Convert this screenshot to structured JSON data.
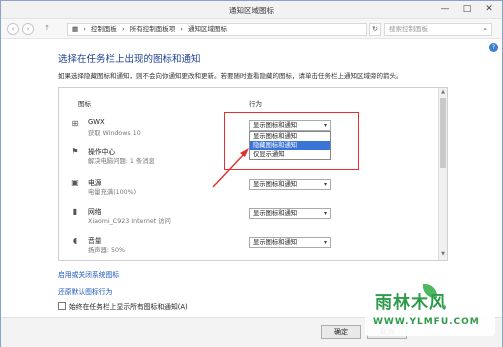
{
  "window": {
    "title": "通知区域图标",
    "min": "—",
    "max": "□",
    "close": "✕"
  },
  "address": {
    "back": "‹",
    "forward": "›",
    "up": "↑",
    "crumbs": [
      "▦",
      "›",
      "控制面板",
      "›",
      "所有控制面板项",
      "›",
      "通知区域图标"
    ],
    "refresh": "↻",
    "search_placeholder": "搜索控制面板",
    "search_icon": "search-icon"
  },
  "help": "?",
  "heading": "选择在任务栏上出现的图标和通知",
  "description": "如果选择隐藏图标和通知，则不会向你通知更改和更新。若要随时查看隐藏的图标，请单击任务栏上通知区域旁的箭头。",
  "table": {
    "col_icon": "图标",
    "col_behavior": "行为",
    "rows": [
      {
        "icon": "windows-icon",
        "glyph": "⊞",
        "name": "GWX",
        "sub": "获取 Windows 10",
        "value": "显示图标和通知"
      },
      {
        "icon": "flag-icon",
        "glyph": "⚑",
        "name": "操作中心",
        "sub": "解决电脑问题: 1 条消息",
        "value": ""
      },
      {
        "icon": "battery-icon",
        "glyph": "▣",
        "name": "电源",
        "sub": "电量充满(100%)",
        "value": "显示图标和通知"
      },
      {
        "icon": "network-icon",
        "glyph": "▮",
        "name": "网络",
        "sub": "Xiaomi_C923 Internet 访问",
        "value": "显示图标和通知"
      },
      {
        "icon": "speaker-icon",
        "glyph": "◖",
        "name": "音量",
        "sub": "扬声器: 50%",
        "value": "显示图标和通知"
      }
    ],
    "dropdown_options": [
      "显示图标和通知",
      "隐藏图标和通知",
      "仅显示通知"
    ],
    "dropdown_selected_index": 1
  },
  "links": {
    "system_icons": "启用或关闭系统图标",
    "restore": "还原默认图标行为"
  },
  "checkbox": {
    "label": "始终在任务栏上显示所有图标和通知(A)",
    "checked": false
  },
  "footer": {
    "ok": "确定",
    "cancel": "取消"
  },
  "watermark": {
    "main": "雨林木风",
    "url": "WWW.YLMFU.COM"
  },
  "colors": {
    "accent": "#1e3f8f",
    "highlight": "#e03030",
    "selection": "#3a74d6",
    "watermark": "#2d9b4a"
  }
}
